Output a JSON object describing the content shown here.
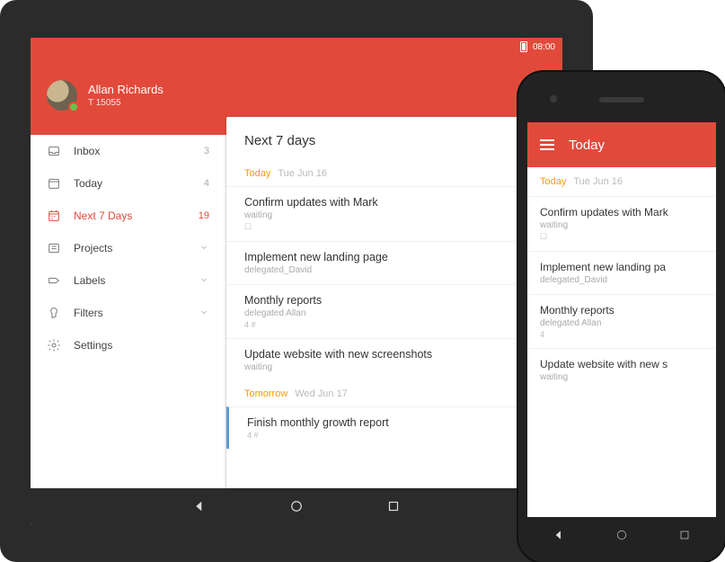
{
  "status": {
    "time": "08:00"
  },
  "user": {
    "name": "Allan Richards",
    "subtitle": "T 15055"
  },
  "sidebar": {
    "items": [
      {
        "id": "inbox",
        "label": "Inbox",
        "count": "3"
      },
      {
        "id": "today",
        "label": "Today",
        "count": "4"
      },
      {
        "id": "next7",
        "label": "Next 7 Days",
        "count": "19",
        "active": true
      },
      {
        "id": "projects",
        "label": "Projects",
        "expandable": true
      },
      {
        "id": "labels",
        "label": "Labels",
        "expandable": true
      },
      {
        "id": "filters",
        "label": "Filters",
        "expandable": true
      },
      {
        "id": "settings",
        "label": "Settings"
      }
    ]
  },
  "panel": {
    "title": "Next 7 days",
    "sections": [
      {
        "name": "Today",
        "date": "Tue Jun 16",
        "tasks": [
          {
            "title": "Confirm updates with Mark",
            "sub": "waiting",
            "micro": "☐"
          },
          {
            "title": "Implement new landing page",
            "sub": "delegated_David"
          },
          {
            "title": "Monthly reports",
            "sub": "delegated Allan",
            "micro": "4 #"
          },
          {
            "title": "Update website with new screenshots",
            "sub": "waiting"
          }
        ]
      },
      {
        "name": "Tomorrow",
        "date": "Wed Jun 17",
        "tasks": [
          {
            "title": "Finish monthly growth report",
            "micro": "4 #",
            "bar": true
          }
        ]
      }
    ]
  },
  "phone": {
    "title": "Today",
    "section": {
      "name": "Today",
      "date": "Tue Jun 16"
    },
    "tasks": [
      {
        "title": "Confirm updates with Mark",
        "sub": "waiting",
        "micro": "☐"
      },
      {
        "title": "Implement new landing pa",
        "sub": "delegated_David"
      },
      {
        "title": "Monthly reports",
        "sub": "delegated Allan",
        "micro": "4"
      },
      {
        "title": "Update website with new s",
        "sub": "waiting"
      }
    ]
  }
}
